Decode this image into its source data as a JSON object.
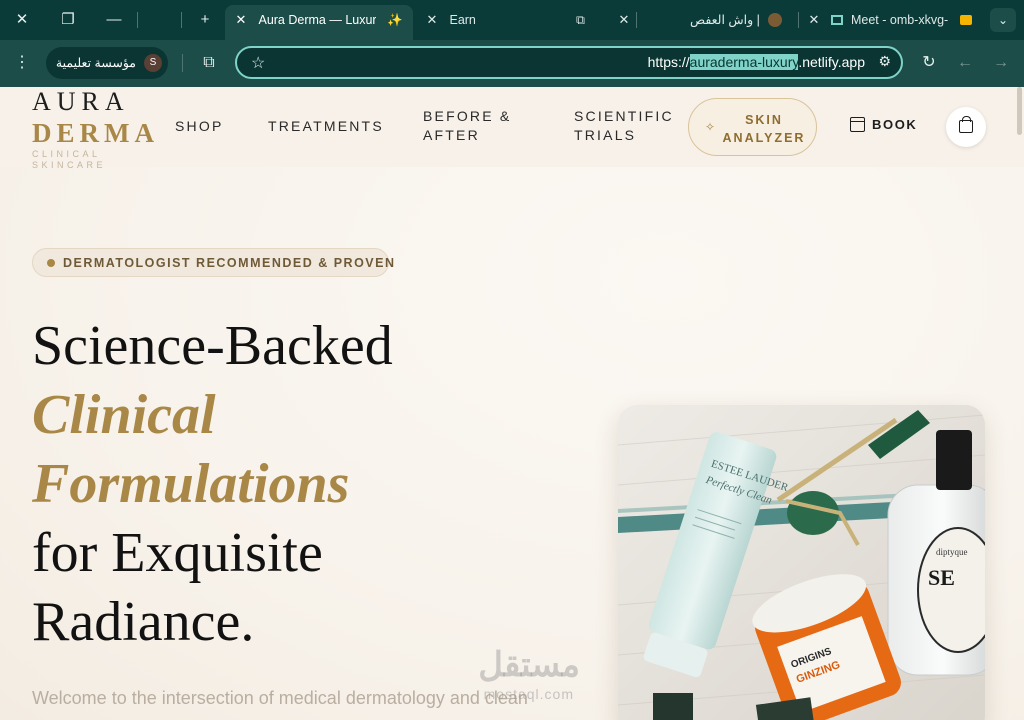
{
  "browser": {
    "tabs": [
      {
        "title": "Aura Derma — Luxury",
        "active": true,
        "icon": "sparkle-icon"
      },
      {
        "title": "Earn",
        "active": false,
        "icon": "puzzle-icon"
      },
      {
        "title": "واش العفص |",
        "active": false,
        "icon": "avatar-icon"
      },
      {
        "title": "Meet - omb-xkvg-",
        "active": false,
        "icon": "video-camera-icon"
      }
    ],
    "profile_label": "مؤسسة تعليمية",
    "profile_initial": "S",
    "url_prefix": "https://",
    "url_highlight": "auraderma-luxury",
    "url_suffix": ".netlify.app",
    "colors": {
      "frame": "#0b3b38",
      "toolbar": "#1d4d49",
      "omnibox_border": "#7fd3c9"
    }
  },
  "site": {
    "logo_line1": "AURA",
    "logo_line2": "DERMA",
    "logo_tagline": "CLINICAL SKINCARE",
    "nav": {
      "shop": "SHOP",
      "treatments": "TREATMENTS",
      "before_after_1": "BEFORE &",
      "before_after_2": "AFTER",
      "trials_1": "SCIENTIFIC",
      "trials_2": "TRIALS",
      "analyzer_1": "SKIN",
      "analyzer_2": "ANALYZER",
      "book": "BOOK"
    },
    "badge": "DERMATOLOGIST RECOMMENDED & PROVEN",
    "headline": {
      "line1": "Science-Backed",
      "line2": "Clinical",
      "line3": "Formulations",
      "line4": "for Exquisite",
      "line5": "Radiance."
    },
    "intro": "Welcome to the intersection of medical dermatology and clean",
    "photo_labels": {
      "tube_brand": "ESTEE LAUDER",
      "tube_name": "Perfectly Clean",
      "jar_brand": "ORIGINS",
      "jar_name": "GINZING",
      "bottle_label": "diptyque"
    },
    "colors": {
      "gold": "#a98847",
      "ink": "#121212",
      "cream": "#f8f3ec"
    }
  },
  "watermark": {
    "arabic": "مستقل",
    "latin": "mostaql.com"
  }
}
